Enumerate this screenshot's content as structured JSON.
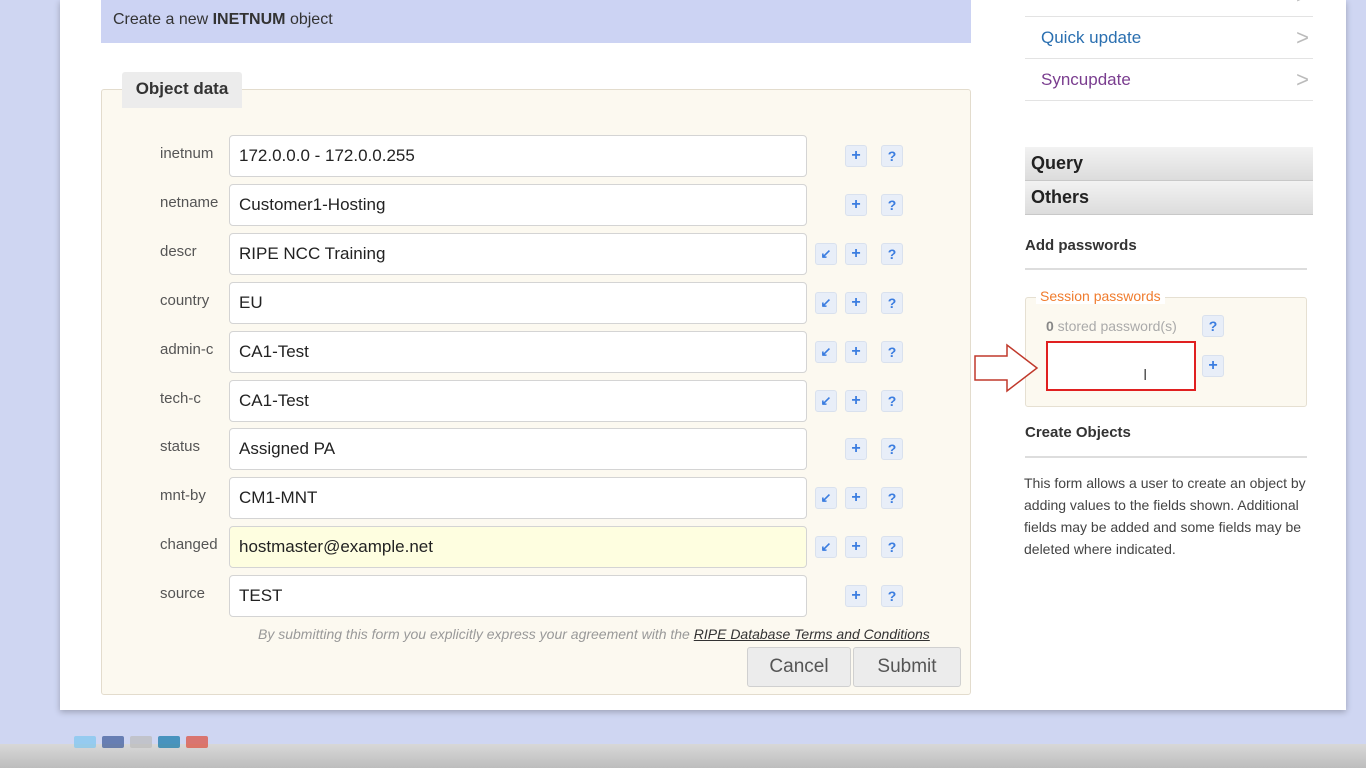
{
  "banner": {
    "prefix": "Create a new ",
    "object_type": "INETNUM",
    "suffix": " object"
  },
  "panel": {
    "tab_label": "Object data"
  },
  "fields": [
    {
      "label": "inetnum",
      "value": "172.0.0.0 - 172.0.0.255",
      "has_arrow": false
    },
    {
      "label": "netname",
      "value": "Customer1-Hosting",
      "has_arrow": false
    },
    {
      "label": "descr",
      "value": "RIPE NCC Training",
      "has_arrow": true
    },
    {
      "label": "country",
      "value": "EU",
      "has_arrow": true
    },
    {
      "label": "admin-c",
      "value": "CA1-Test",
      "has_arrow": true
    },
    {
      "label": "tech-c",
      "value": "CA1-Test",
      "has_arrow": true
    },
    {
      "label": "status",
      "value": "Assigned PA",
      "has_arrow": false
    },
    {
      "label": "mnt-by",
      "value": "CM1-MNT",
      "has_arrow": true
    },
    {
      "label": "changed",
      "value": "hostmaster@example.net",
      "has_arrow": true,
      "highlight": true
    },
    {
      "label": "source",
      "value": "TEST",
      "has_arrow": false
    }
  ],
  "icons": {
    "arrow": "↙",
    "plus": "+",
    "help": "?"
  },
  "agreement": {
    "text": "By submitting this form you explicitly express your agreement with the ",
    "link": "RIPE Database Terms and Conditions"
  },
  "buttons": {
    "cancel": "Cancel",
    "submit": "Submit"
  },
  "sidebar": {
    "links": [
      {
        "label": "Quick update",
        "color": "#2a6fb0"
      },
      {
        "label": "Syncupdate",
        "color": "#7a3d8f"
      }
    ],
    "chevron": ">",
    "accordions": [
      "Query",
      "Others"
    ],
    "add_passwords_heading": "Add passwords",
    "session_legend": "Session passwords",
    "stored_count": "0",
    "stored_label": " stored password(s)",
    "create_objects_heading": "Create Objects",
    "description": "This form allows a user to create an object by adding values to the fields shown. Additional fields may be added and some fields may be deleted where indicated."
  },
  "colors": {
    "banner_bg": "#ccd3f3",
    "highlight_red": "#e02020",
    "accent_blue": "#3b7de0",
    "session_orange": "#f07c2e"
  }
}
